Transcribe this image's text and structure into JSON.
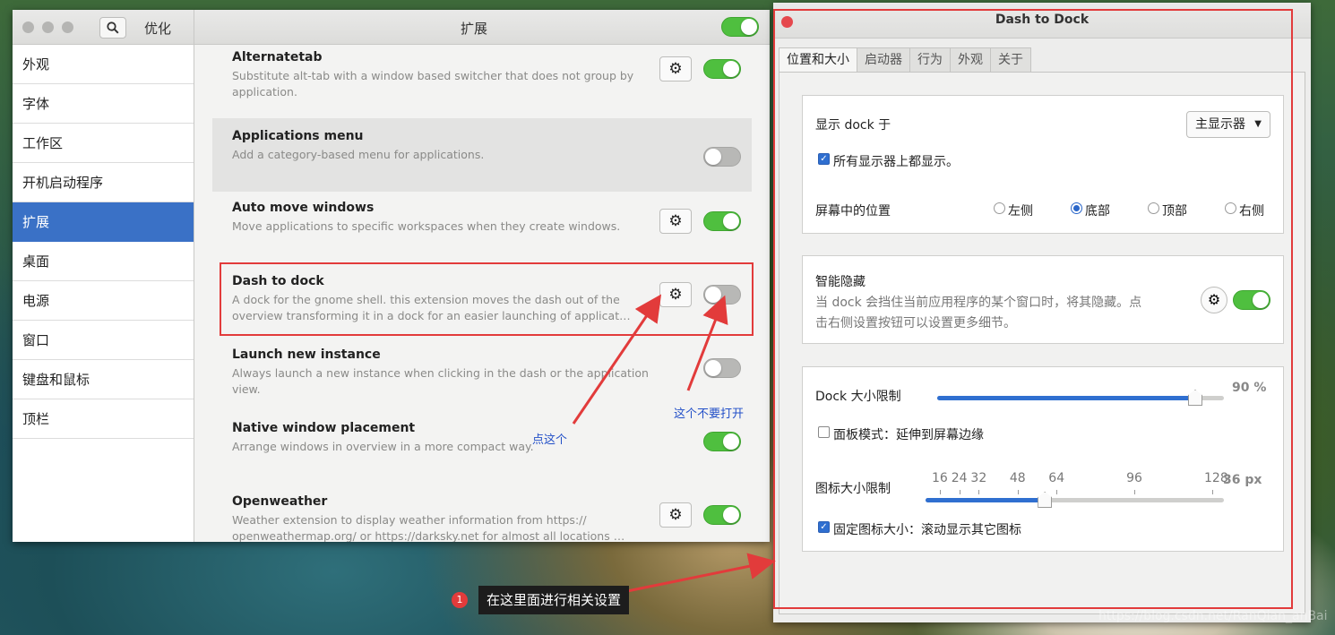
{
  "tweaks": {
    "app_title": "优化",
    "section_title": "扩展",
    "sidebar": [
      "外观",
      "字体",
      "工作区",
      "开机启动程序",
      "扩展",
      "桌面",
      "电源",
      "窗口",
      "键盘和鼠标",
      "顶栏"
    ],
    "active_sidebar_index": 4,
    "master_switch_on": true,
    "extensions": [
      {
        "name": "Alternatetab",
        "desc": "Substitute alt-tab with a window based switcher that does not group by application.",
        "has_settings": true,
        "enabled": true
      },
      {
        "name": "Applications menu",
        "desc": "Add a category-based menu for applications.",
        "has_settings": false,
        "enabled": false
      },
      {
        "name": "Auto move windows",
        "desc": "Move applications to specific workspaces when they create windows.",
        "has_settings": true,
        "enabled": true
      },
      {
        "name": "Dash to dock",
        "desc": "A dock for the gnome shell. this extension moves the dash out of the overview transforming it in a dock for an easier launching of applicat…",
        "has_settings": true,
        "enabled": false
      },
      {
        "name": "Launch new instance",
        "desc": "Always launch a new instance when clicking in the dash or the application view.",
        "has_settings": false,
        "enabled": false
      },
      {
        "name": "Native window placement",
        "desc": "Arrange windows in overview in a more compact way.",
        "has_settings": false,
        "enabled": true
      },
      {
        "name": "Openweather",
        "desc": "Weather extension to display weather information from https:// openweathermap.org/ or https://darksky.net for almost all locations …",
        "has_settings": true,
        "enabled": true
      }
    ]
  },
  "dtd": {
    "title": "Dash to Dock",
    "tabs": [
      "位置和大小",
      "启动器",
      "行为",
      "外观",
      "关于"
    ],
    "active_tab": 0,
    "show_dock_on": "显示 dock 于",
    "show_dock_on_b": "dock",
    "monitor_select": "主显示器",
    "all_monitors": "所有显示器上都显示。",
    "all_monitors_checked": true,
    "position_label": "屏幕中的位置",
    "positions": [
      "左侧",
      "底部",
      "顶部",
      "右侧"
    ],
    "position_selected": 1,
    "intellihide_title": "智能隐藏",
    "intellihide_desc1": "当 dock 会挡住当前应用程序的某个窗口时，将其隐藏。点",
    "intellihide_desc2": "击右侧设置按钮可以设置更多细节。",
    "intellihide_on": true,
    "dock_size_label": "Dock 大小限制",
    "dock_size_value": "90 %",
    "dock_size_fraction": 0.9,
    "panel_mode": "面板模式：延伸到屏幕边缘",
    "panel_mode_checked": false,
    "icon_size_label": "图标大小限制",
    "icon_ticks": [
      "16",
      "24",
      "32",
      "48",
      "64",
      "96",
      "128"
    ],
    "icon_size_value": "36 px",
    "icon_size_fraction": 0.4,
    "fixed_icon": "固定图标大小：滚动显示其它图标",
    "fixed_icon_checked": true
  },
  "annotations": {
    "click_this": "点这个",
    "dont_enable": "这个不要打开",
    "callout_number": "1",
    "callout_text": "在这里面进行相关设置",
    "accent": "#e23b3b",
    "note_color": "#2350c8"
  },
  "watermark": "https://blog.csdn.net/RanQian_anBai"
}
